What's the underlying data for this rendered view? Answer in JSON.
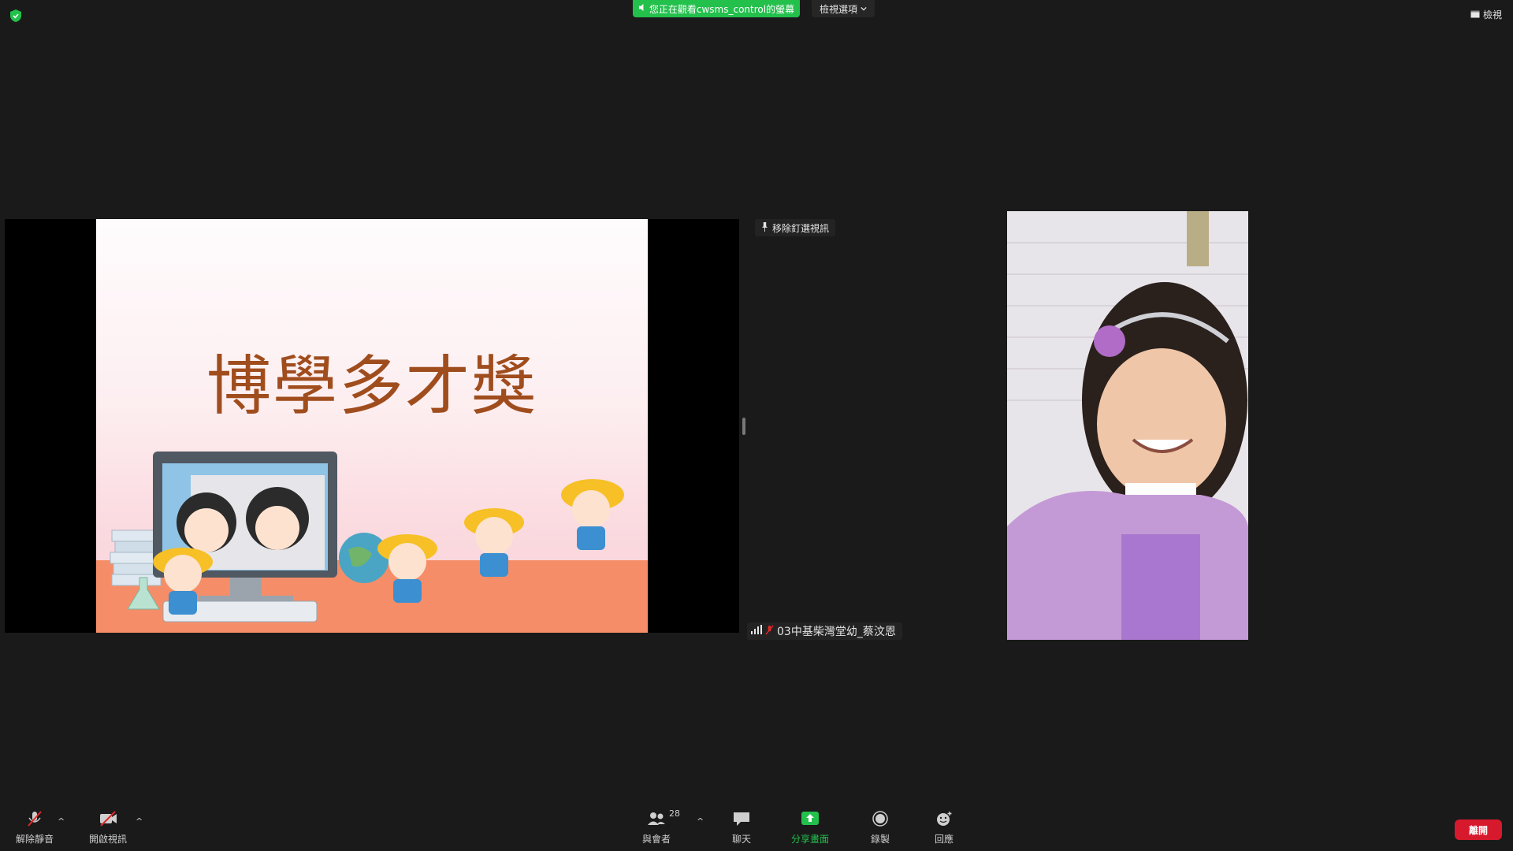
{
  "top_bar": {
    "share_banner": "您正在觀看cwsms_control的螢幕",
    "view_options": "檢視選項",
    "view_mode": "檢視"
  },
  "slide": {
    "title": "博學多才獎"
  },
  "video": {
    "pin_label": "移除釘選視訊",
    "participant_name": "03中基柴灣堂幼_蔡汶恩"
  },
  "toolbar": {
    "unmute": "解除靜音",
    "start_video": "開啟視訊",
    "participants": "與會者",
    "participants_count": "28",
    "chat": "聊天",
    "share_screen": "分享畫面",
    "record": "錄製",
    "reactions": "回應",
    "leave": "離開"
  },
  "colors": {
    "background": "#1a1a1a",
    "share_green": "#23c04c",
    "leave_red": "#d7192d",
    "title_brown": "#a04d1e"
  },
  "icons": [
    "shield-icon",
    "speaker-icon",
    "chevron-down-icon",
    "view-icon",
    "pin-icon",
    "signal-icon",
    "mic-muted-icon",
    "video-muted-icon",
    "participants-icon",
    "chat-icon",
    "share-screen-icon",
    "record-icon",
    "reactions-icon"
  ]
}
